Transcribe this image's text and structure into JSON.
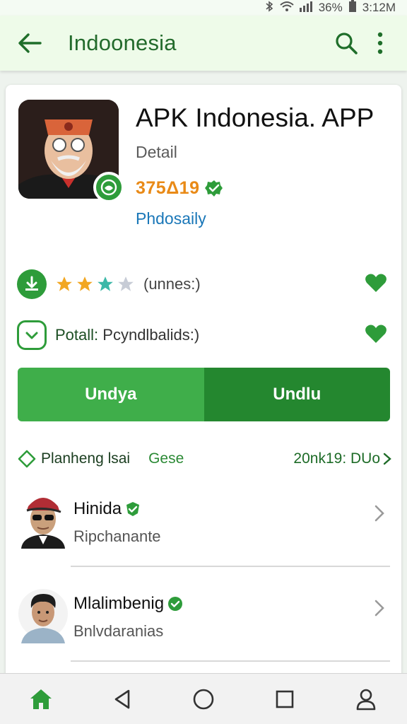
{
  "status_bar": {
    "battery": "36%",
    "time": "3:12M"
  },
  "app_bar": {
    "title": "Indoonesia"
  },
  "app": {
    "title": "APK Indonesia. APP",
    "detail_label": "Detail",
    "downloads": "375Δ19",
    "publisher": "Phdosaily",
    "rating": 3.5,
    "reviews_label": "(unnes:)",
    "install_label": "Potall:",
    "install_sub": "Pcyndlbalids:)"
  },
  "buttons": {
    "primary": "Undya",
    "secondary": "Undlu"
  },
  "section": {
    "title": "Planheng lsai",
    "tab": "Gese",
    "more": "20nk19: DUo"
  },
  "users": [
    {
      "name": "Hinida",
      "sub": "Ripchanante"
    },
    {
      "name": "Mlalimbenig",
      "sub": "Bnlvdaranias"
    }
  ],
  "colors": {
    "brand_green": "#2e9c3a",
    "button_primary": "#3fae4a",
    "button_secondary": "#24872f",
    "downloads_orange": "#e98a17",
    "publisher_blue": "#1a77b8"
  }
}
